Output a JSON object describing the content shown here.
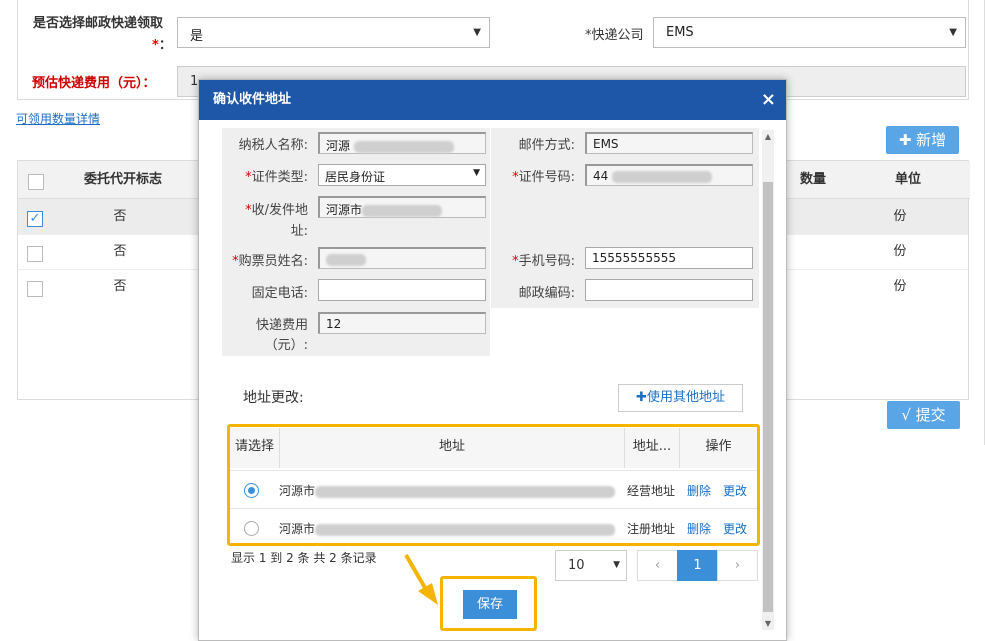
{
  "background": {
    "postal_label": "是否选择邮政快递领取",
    "required_star": "*",
    "colon": "：",
    "postal_value": "是",
    "courier_label": "*快递公司",
    "courier_value": "EMS",
    "fee_label": "预估快递费用（元）：",
    "fee_value": "1",
    "detail_link": "可领用数量详情",
    "add_button": "新增",
    "submit_button": "√ 提交",
    "table": {
      "headers": [
        "委托代开标志",
        "数量",
        "单位"
      ],
      "rows": [
        {
          "flag": "否",
          "unit": "份",
          "checked": true
        },
        {
          "flag": "否",
          "unit": "份",
          "checked": false
        },
        {
          "flag": "否",
          "unit": "份",
          "checked": false
        }
      ]
    }
  },
  "dialog": {
    "title": "确认收件地址",
    "close_symbol": "×",
    "fields": {
      "taxpayer_label": "纳税人名称:",
      "taxpayer_value": "河源",
      "mail_method_label": "邮件方式:",
      "mail_method_value": "EMS",
      "id_type_label": "证件类型:",
      "id_type_value": "居民身份证",
      "id_number_label": "证件号码:",
      "id_number_value": "44",
      "address_label_1": "收/发件地",
      "address_label_2": "址:",
      "address_value": "河源市",
      "buyer_label": "购票员姓名:",
      "phone_label": "手机号码:",
      "phone_value": "15555555555",
      "landline_label": "固定电话:",
      "zipcode_label": "邮政编码:",
      "fee_label_1": "快递费用",
      "fee_label_2": "（元）:",
      "fee_value": "12"
    },
    "address_change_title": "地址更改:",
    "use_other_address_button": "使用其他地址",
    "address_table": {
      "headers": [
        "请选择",
        "地址",
        "地址...",
        "操作"
      ],
      "rows": [
        {
          "address": "河源市",
          "type": "经营地址",
          "delete": "删除",
          "edit": "更改",
          "selected": true
        },
        {
          "address": "河源市",
          "type": "注册地址",
          "delete": "删除",
          "edit": "更改",
          "selected": false
        }
      ]
    },
    "pager": {
      "info": "显示 1 到 2 条 共 2 条记录",
      "page_size": "10",
      "prev": "‹",
      "current_page": "1",
      "next": "›"
    },
    "save_button": "保存"
  }
}
